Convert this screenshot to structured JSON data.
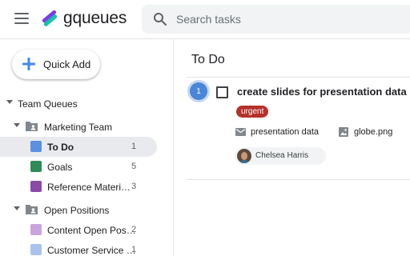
{
  "app": {
    "name": "gqueues"
  },
  "search": {
    "placeholder": "Search tasks"
  },
  "sidebar": {
    "quick_add_label": "Quick Add",
    "section": {
      "label": "Team Queues"
    },
    "groups": [
      {
        "label": "Marketing Team",
        "items": [
          {
            "label": "To Do",
            "count": "1",
            "color": "#5b8fe0",
            "selected": true
          },
          {
            "label": "Goals",
            "count": "5",
            "color": "#2e8b57"
          },
          {
            "label": "Reference Materi…",
            "count": "3",
            "color": "#8a4aa6"
          }
        ]
      },
      {
        "label": "Open Positions",
        "items": [
          {
            "label": "Content Open Pos…",
            "count": "2",
            "color": "#c9a5dd"
          },
          {
            "label": "Customer Service …",
            "count": "1",
            "color": "#a9c3f0"
          }
        ]
      }
    ]
  },
  "main": {
    "title": "To Do",
    "task": {
      "number": "1",
      "title": "create slides for presentation data",
      "tag": "urgent",
      "tag_color": "#b5312a",
      "attachments": [
        "presentation data",
        "globe.png"
      ],
      "assignee": "Chelsea Harris"
    }
  },
  "colors": {
    "accent": "#4285f4",
    "logo_purple": "#7b3fe4",
    "logo_teal": "#15c3a6"
  }
}
